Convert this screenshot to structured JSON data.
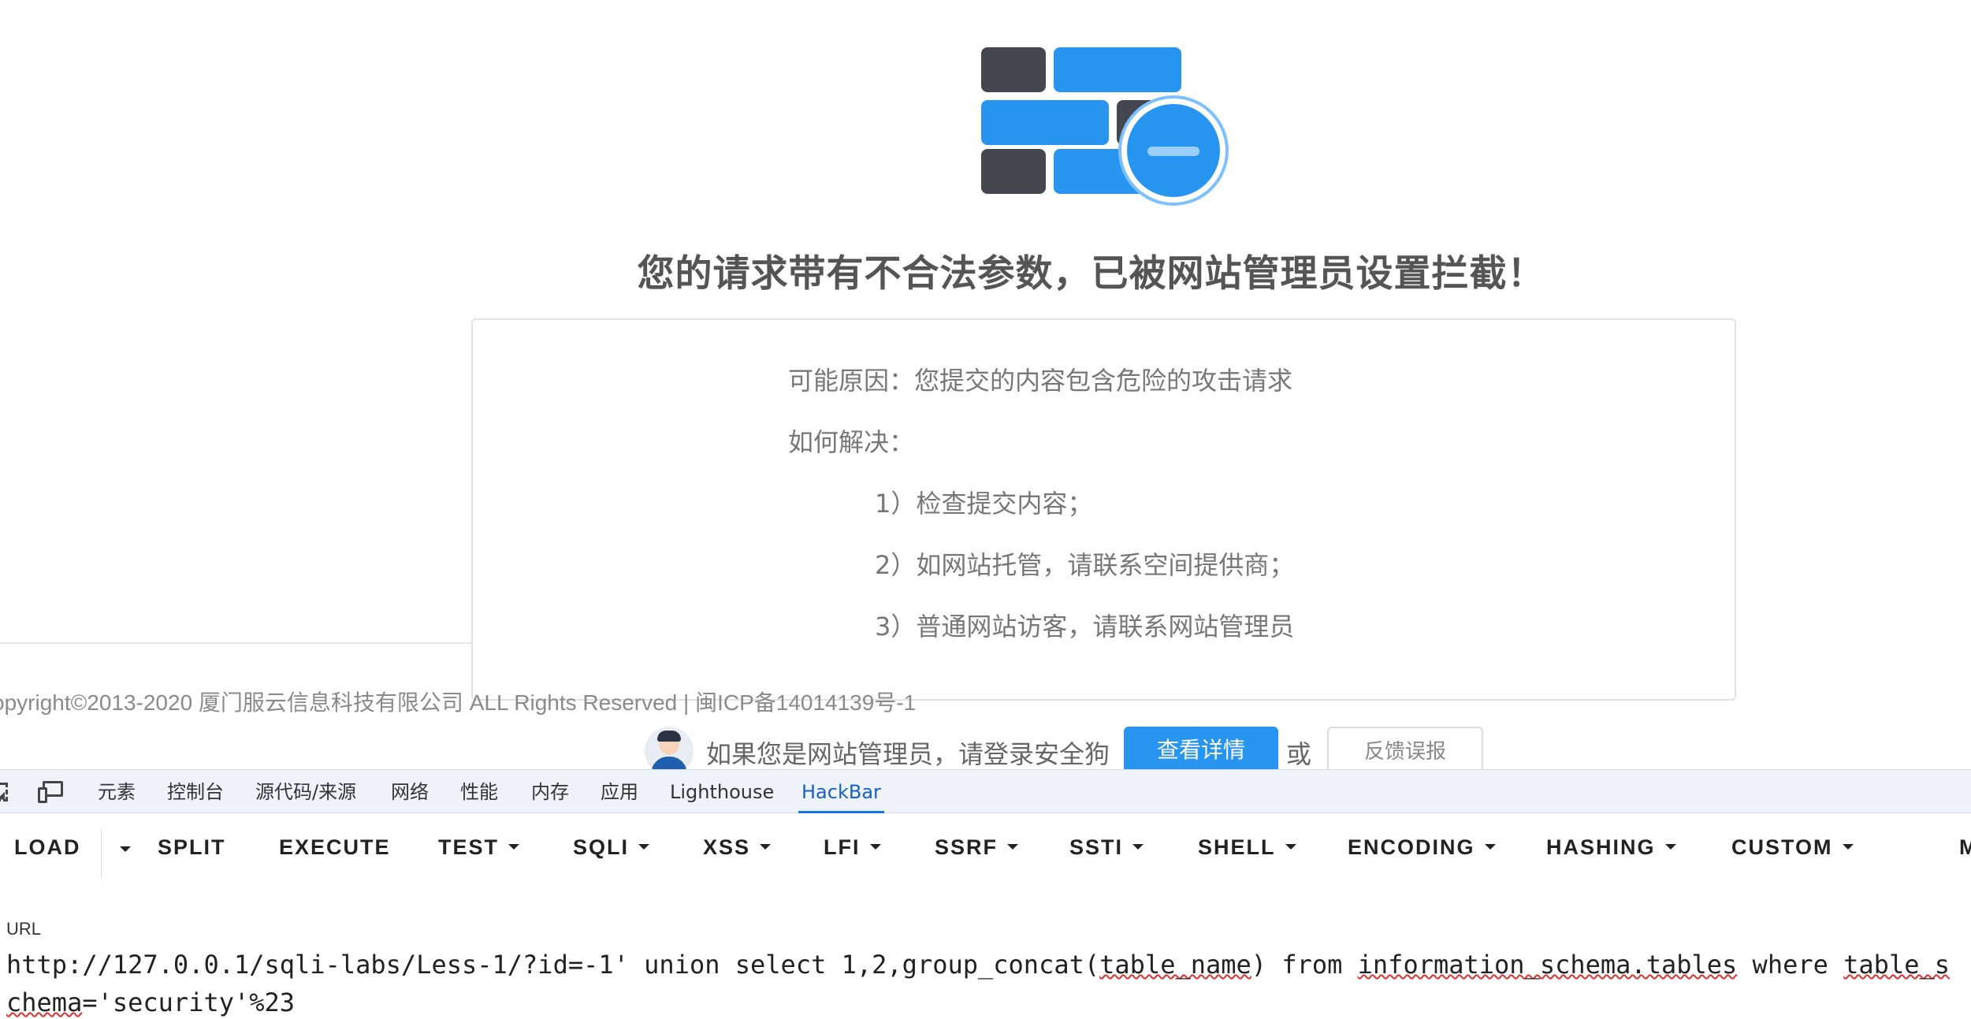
{
  "blocked_page": {
    "headline": "您的请求带有不合法参数，已被网站管理员设置拦截！",
    "reason_line": "可能原因：您提交的内容包含危险的攻击请求",
    "solve_label": "如何解决：",
    "steps": [
      "1）检查提交内容；",
      "2）如网站托管，请联系空间提供商；",
      "3）普通网站访客，请联系网站管理员"
    ],
    "copyright": "opyright©2013-2020 厦门服云信息科技有限公司 ALL Rights Reserved | 闽ICP备14014139号-1",
    "admin_prompt": "如果您是网站管理员，请登录安全狗",
    "detail_button": "查看详情",
    "or_text": "或",
    "report_button": "反馈误报",
    "colors": {
      "brand_blue": "#2896f0",
      "brick_dark": "#444750"
    }
  },
  "devtools": {
    "tabs": [
      "元素",
      "控制台",
      "源代码/来源",
      "网络",
      "性能",
      "内存",
      "应用",
      "Lighthouse",
      "HackBar"
    ],
    "active_tab": "HackBar"
  },
  "hackbar": {
    "buttons": [
      "LOAD",
      "SPLIT",
      "EXECUTE",
      "TEST",
      "SQLI",
      "XSS",
      "LFI",
      "SSRF",
      "SSTI",
      "SHELL",
      "ENCODING",
      "HASHING",
      "CUSTOM"
    ],
    "cut_off_button": "M",
    "url_label": "URL",
    "url_parts": [
      "http://127.0.0.1/sqli-labs/Less-1/?id=-1' union select 1,2,group_concat(",
      "table_name",
      ") from ",
      "information_schema.tables",
      " where ",
      "table_schema",
      "='security'%23"
    ]
  }
}
